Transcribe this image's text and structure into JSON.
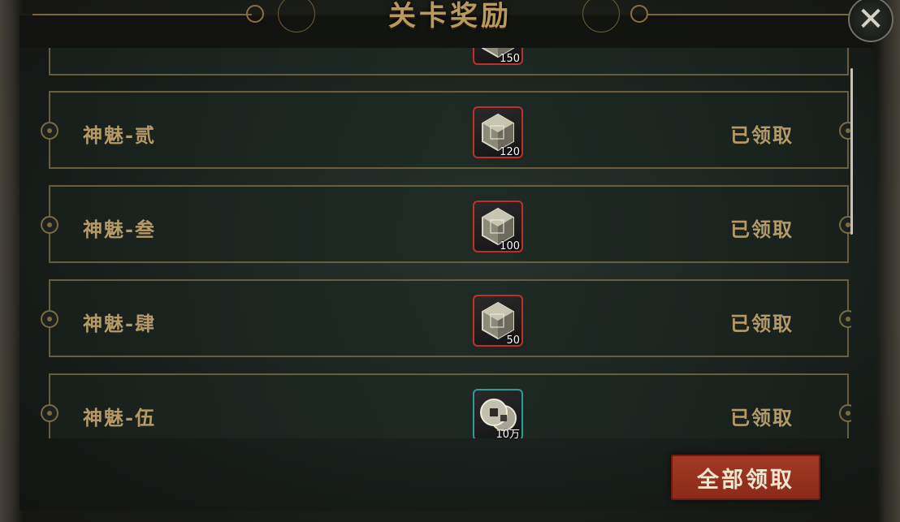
{
  "header": {
    "title": "关卡奖励"
  },
  "rewards": [
    {
      "name": "",
      "status": "",
      "item_icon": "crystal-cube-icon",
      "count": "150",
      "border_color": "#c0302a"
    },
    {
      "name": "神魅-贰",
      "status": "已领取",
      "item_icon": "crystal-cube-icon",
      "count": "120",
      "border_color": "#c0302a"
    },
    {
      "name": "神魅-叁",
      "status": "已领取",
      "item_icon": "crystal-cube-icon",
      "count": "100",
      "border_color": "#c0302a"
    },
    {
      "name": "神魅-肆",
      "status": "已领取",
      "item_icon": "crystal-cube-icon",
      "count": "50",
      "border_color": "#c0302a"
    },
    {
      "name": "神魅-伍",
      "status": "已领取",
      "item_icon": "coins-icon",
      "count": "10万",
      "border_color": "#2e9c93"
    }
  ],
  "footer": {
    "claim_all_label": "全部领取"
  },
  "close": {
    "icon": "close-icon",
    "glyph": "✕"
  }
}
